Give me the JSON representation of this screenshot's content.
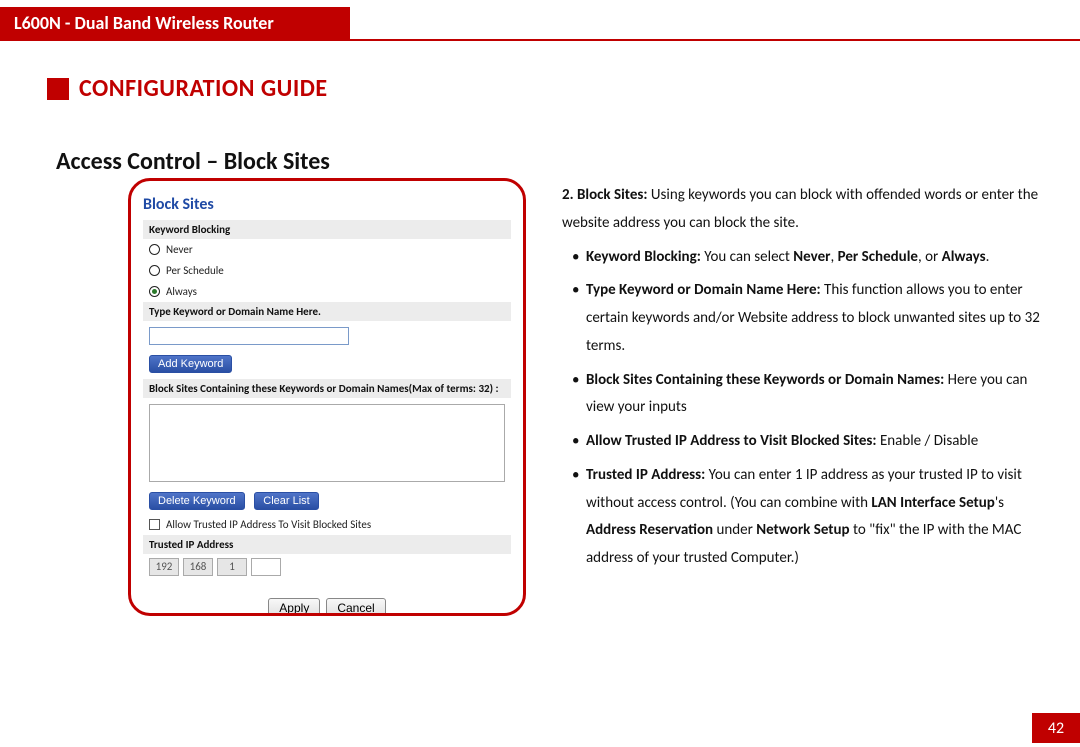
{
  "header": {
    "product": "L600N - Dual Band Wireless Router"
  },
  "section": {
    "title": "CONFIGURATION GUIDE"
  },
  "subsection": {
    "title": "Access Control – Block Sites"
  },
  "panel": {
    "title": "Block Sites",
    "keyword_blocking_header": "Keyword Blocking",
    "radio_never": "Never",
    "radio_per_schedule": "Per Schedule",
    "radio_always": "Always",
    "type_keyword_header": "Type Keyword or Domain Name Here.",
    "add_keyword_btn": "Add Keyword",
    "block_list_header": "Block Sites Containing these Keywords or Domain Names(Max of terms: 32) :",
    "delete_keyword_btn": "Delete Keyword",
    "clear_list_btn": "Clear List",
    "allow_trusted_chk": "Allow Trusted IP Address To Visit Blocked Sites",
    "trusted_ip_header": "Trusted IP Address",
    "ip_a": "192",
    "ip_b": "168",
    "ip_c": "1",
    "apply_btn": "Apply",
    "cancel_btn": "Cancel"
  },
  "desc": {
    "intro_num": "2. Block Sites:",
    "intro_rest": " Using keywords you can block with offended words or enter the website address you can block the site.",
    "kb_label": "Keyword Blocking:",
    "kb_rest1": " You can select ",
    "kb_never": "Never",
    "kb_comma": ", ",
    "kb_per": "Per Schedule",
    "kb_or": ", or ",
    "kb_always": "Always",
    "kb_period": ".",
    "tk_label": "Type Keyword or Domain Name Here:",
    "tk_rest": " This function allows you to enter certain keywords and/or Website address to block unwanted sites up to 32 terms.",
    "bs_label": "Block Sites Containing these Keywords or Domain Names:",
    "bs_rest": " Here you can view your inputs",
    "at_label": "Allow Trusted IP Address to Visit Blocked Sites:",
    "at_rest": " Enable / Disable",
    "ti_label": "Trusted IP Address:",
    "ti_rest1": " You can enter 1 IP address as your trusted IP to visit without access control. (You can combine with ",
    "ti_lan": "LAN Interface Setup",
    "ti_s": "'s ",
    "ti_ar": "Address Reservation",
    "ti_under": " under ",
    "ti_ns": "Network Setup",
    "ti_rest2": " to \"fix\" the IP with the MAC address of your trusted Computer.)"
  },
  "page": {
    "number": "42"
  }
}
